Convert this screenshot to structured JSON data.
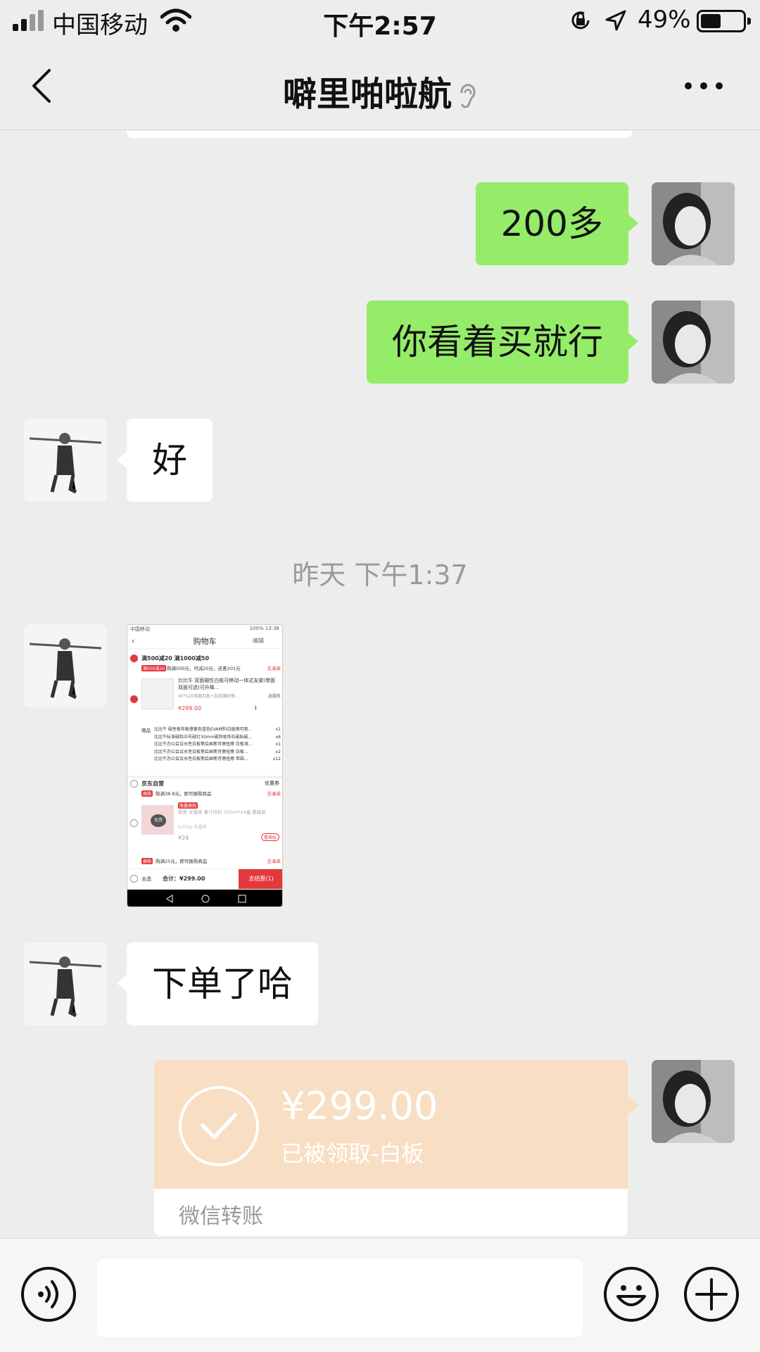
{
  "status_bar": {
    "carrier": "中国移动",
    "time": "下午2:57",
    "battery_percent": "49%",
    "battery_level": 0.49
  },
  "nav": {
    "title": "噼里啪啦航",
    "back_icon": "chevron-left-icon",
    "more_icon": "more-dots-icon",
    "muted_icon": "ear-icon"
  },
  "messages": [
    {
      "side": "me",
      "text": "200多"
    },
    {
      "side": "me",
      "text": "你看着买就行"
    },
    {
      "side": "them",
      "text": "好"
    },
    {
      "side": "them",
      "text": "下单了哈"
    }
  ],
  "timestamp": "昨天 下午1:37",
  "screenshot": {
    "status_left": "中国移动",
    "status_right": "100% 13:36",
    "header_title": "购物车",
    "header_edit": "编辑",
    "promo": "满500减20 满1000减50",
    "promo_tag": "满500减20",
    "promo_note": "购满500元，可减20元，还差201元",
    "go_add": "去凑单",
    "product_title": "比比牛 双面磁性白板可移动一体式支架(带面双面可选)可升降...",
    "product_spec": "90*120双面白板+加厚磨砂推...",
    "product_spec_btn": "选服务",
    "product_price": "¥299.00",
    "product_qty": "1",
    "gift_label": "赠品",
    "gifts": [
      {
        "name": "比比牛 磁性板布板擦黄色蓝色EVA材料白板擦可吸...",
        "qty": "x1"
      },
      {
        "name": "比比牛标准磁粒中号磁钉30mm磁铁吸铁石磁贴磁...",
        "qty": "x6"
      },
      {
        "name": "比比牛办公会议水性白板笔绘画笔可擦扭擦 白板液...",
        "qty": "x1"
      },
      {
        "name": "比比牛办公会议水性白板笔绘画笔可擦扭擦 白板...",
        "qty": "x2"
      },
      {
        "name": "比比牛办公会议水性白板笔绘画笔可擦扭擦 带磁...",
        "qty": "x12"
      }
    ],
    "store": "京东自营",
    "coupon": "优惠券",
    "store_promo_tag": "换购",
    "store_promo": "购满38.8元，即可换购商品",
    "go_shop": "去凑单",
    "item2_tag": "限量换购",
    "item2_title": "和舍 水蜜桃 果汁饮料 250ml*24盒 整箱装",
    "item2_spec": "6.05kg 水蜜桃",
    "item2_img": "无货",
    "item2_price": "¥24",
    "item2_btn": "看相似",
    "promo3_tag": "换购",
    "promo3": "购满25元，即可换购商品",
    "select_all": "全选",
    "total": "合计：¥299.00",
    "checkout": "去结算(1)"
  },
  "transfer": {
    "amount": "¥299.00",
    "description": "已被领取-白板",
    "type": "微信转账"
  },
  "input_bar": {
    "voice_icon": "voice-icon",
    "emoji_icon": "emoji-icon",
    "plus_icon": "plus-icon"
  }
}
